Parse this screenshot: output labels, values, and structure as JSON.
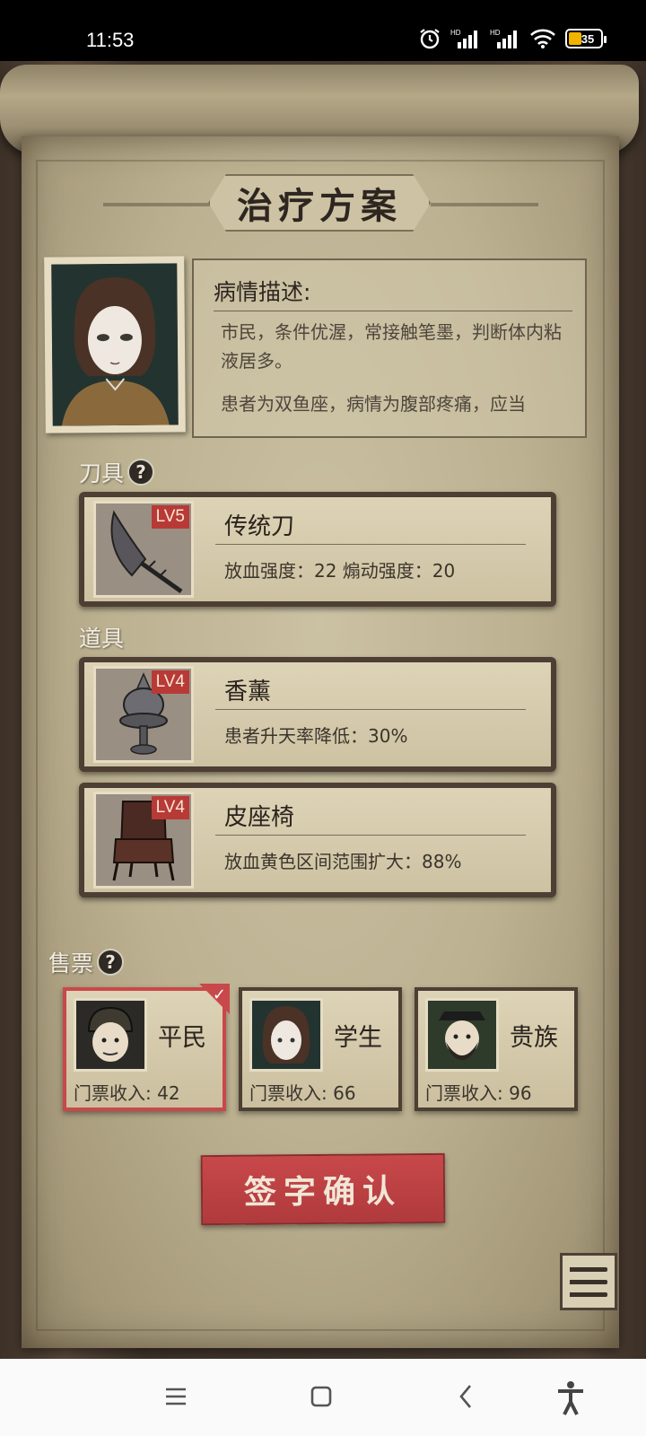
{
  "status_bar": {
    "time": "11:53",
    "battery": "35",
    "icons": [
      "alarm-icon",
      "hd-signal-icon",
      "hd-signal-icon",
      "wifi-icon",
      "battery-icon"
    ]
  },
  "screen": {
    "title": "治疗方案",
    "description": {
      "heading": "病情描述:",
      "paragraph1": "市民，条件优渥，常接触笔墨，判断体内粘液居多。",
      "paragraph2": "患者为双鱼座，病情为腹部疼痛，应当"
    },
    "knife_section": {
      "label": "刀具",
      "item": {
        "level": "LV5",
        "name": "传统刀",
        "stats": "放血强度：22   煽动强度：20"
      }
    },
    "tool_section": {
      "label": "道具",
      "items": [
        {
          "level": "LV4",
          "name": "香薰",
          "stat": "患者升天率降低：30%"
        },
        {
          "level": "LV4",
          "name": "皮座椅",
          "stat": "放血黄色区间范围扩大：88%"
        }
      ]
    },
    "ticket_section": {
      "label": "售票",
      "tickets": [
        {
          "name": "平民",
          "income": "门票收入: 42",
          "selected": true
        },
        {
          "name": "学生",
          "income": "门票收入: 66",
          "selected": false
        },
        {
          "name": "贵族",
          "income": "门票收入: 96",
          "selected": false
        }
      ]
    },
    "confirm_label": "签字确认"
  },
  "colors": {
    "accent_red": "#c9484a",
    "parchment": "#cbc1a3",
    "dark_wood": "#4d3f33"
  }
}
